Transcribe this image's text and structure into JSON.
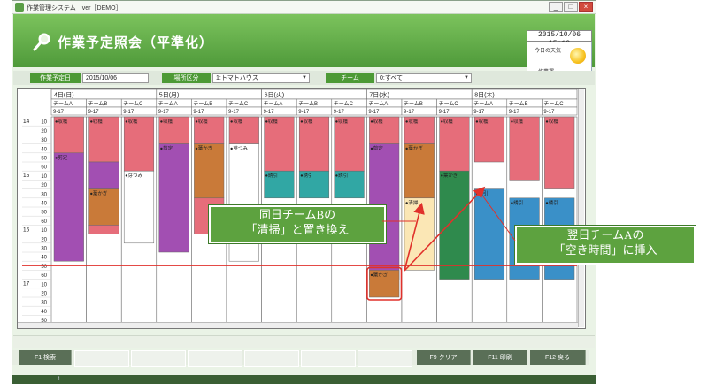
{
  "window": {
    "title": "作業管理システム　ver［DEMO］",
    "controls": [
      "_",
      "□",
      "×"
    ]
  },
  "header": {
    "title": "作業予定照会（平準化）",
    "clock": "2015/10/06  15:12",
    "widget_label_top": "今日の天気",
    "widget_label_bottom": "作業運"
  },
  "filters": {
    "date_label": "作業予定日",
    "date_value": "2015/10/06",
    "place_label": "場所区分",
    "place_value": "1:トマトハウス",
    "team_label": "チーム",
    "team_value": "0:すべて"
  },
  "function_keys": {
    "f1": "F1 検索",
    "f9": "F9 クリア",
    "f11": "F11 印刷",
    "f12": "F12 戻る"
  },
  "annotations": {
    "left_line1": "同日チームBの",
    "left_line2": "「清掃」と置き換え",
    "right_line1": "翌日チームAの",
    "right_line2": "「空き時間」に挿入"
  },
  "colors": {
    "accent_green": "#4f9a3a",
    "pink": "#e66d7a",
    "purple": "#a24fb2",
    "brown": "#c97a39",
    "teal": "#31a7a4",
    "dark_green": "#2f8a4d",
    "blue": "#3a90c8",
    "cream": "#fbe7b5",
    "red_line": "#e0312b"
  },
  "schedule": {
    "days": [
      {
        "label": "4日(日)",
        "teams": [
          "チームA",
          "チームB",
          "チームC"
        ]
      },
      {
        "label": "5日(月)",
        "teams": [
          "チームA",
          "チームB",
          "チームC"
        ]
      },
      {
        "label": "6日(火)",
        "teams": [
          "チームA",
          "チームB",
          "チームC"
        ]
      },
      {
        "label": "7日(水)",
        "teams": [
          "チームA",
          "チームB",
          "チームC"
        ]
      },
      {
        "label": "8日(木)",
        "teams": [
          "チームA",
          "チームB",
          "チームC"
        ]
      }
    ],
    "shift": "9-17",
    "hours": [
      "14",
      "15",
      "16",
      "17"
    ],
    "minutes": [
      "10",
      "20",
      "30",
      "40",
      "50",
      "60",
      "10",
      "20",
      "30",
      "40",
      "50",
      "60",
      "10",
      "20",
      "30",
      "40",
      "50",
      "60",
      "10",
      "20",
      "30",
      "40",
      "50"
    ],
    "columns": [
      [
        {
          "start": 0,
          "end": 4,
          "color": "pink",
          "label": "●収穫"
        },
        {
          "start": 4,
          "end": 16,
          "color": "purple",
          "label": "●剪定"
        }
      ],
      [
        {
          "start": 0,
          "end": 5,
          "color": "pink",
          "label": "●収穫"
        },
        {
          "start": 5,
          "end": 8,
          "color": "purple",
          "label": ""
        },
        {
          "start": 8,
          "end": 12,
          "color": "brown",
          "label": "●葉かぎ"
        },
        {
          "start": 12,
          "end": 13,
          "color": "pink",
          "label": ""
        }
      ],
      [
        {
          "start": 0,
          "end": 6,
          "color": "pink",
          "label": "●収穫"
        },
        {
          "start": 6,
          "end": 14,
          "color": "white",
          "label": "●芽つみ"
        }
      ],
      [
        {
          "start": 0,
          "end": 3,
          "color": "pink",
          "label": "●収穫"
        },
        {
          "start": 3,
          "end": 15,
          "color": "purple",
          "label": "●剪定"
        }
      ],
      [
        {
          "start": 0,
          "end": 3,
          "color": "pink",
          "label": "●収穫"
        },
        {
          "start": 3,
          "end": 9,
          "color": "brown",
          "label": "●葉かぎ"
        },
        {
          "start": 9,
          "end": 13,
          "color": "pink",
          "label": ""
        }
      ],
      [
        {
          "start": 0,
          "end": 3,
          "color": "pink",
          "label": "●収穫"
        },
        {
          "start": 3,
          "end": 16,
          "color": "white",
          "label": "●芽つみ"
        }
      ],
      [
        {
          "start": 0,
          "end": 6,
          "color": "pink",
          "label": "●収穫"
        },
        {
          "start": 6,
          "end": 9,
          "color": "teal",
          "label": "●誘引"
        }
      ],
      [
        {
          "start": 0,
          "end": 6,
          "color": "pink",
          "label": "●収穫"
        },
        {
          "start": 6,
          "end": 9,
          "color": "teal",
          "label": "●誘引"
        }
      ],
      [
        {
          "start": 0,
          "end": 6,
          "color": "pink",
          "label": "●収穫"
        },
        {
          "start": 6,
          "end": 9,
          "color": "teal",
          "label": "●誘引"
        }
      ],
      [
        {
          "start": 0,
          "end": 3,
          "color": "pink",
          "label": "●収穫"
        },
        {
          "start": 3,
          "end": 18,
          "color": "purple",
          "label": "●剪定"
        }
      ],
      [
        {
          "start": 0,
          "end": 3,
          "color": "pink",
          "label": "●収穫"
        },
        {
          "start": 3,
          "end": 9,
          "color": "brown",
          "label": "●葉かぎ"
        },
        {
          "start": 9,
          "end": 17,
          "color": "cream",
          "label": "●清掃"
        }
      ],
      [
        {
          "start": 0,
          "end": 6,
          "color": "pink",
          "label": "●収穫"
        },
        {
          "start": 6,
          "end": 18,
          "color": "dark_green",
          "label": "●葉かぎ"
        }
      ],
      [
        {
          "start": 0,
          "end": 5,
          "color": "pink",
          "label": "●収穫"
        },
        {
          "start": 8,
          "end": 18,
          "color": "blue",
          "label": "●誘引"
        }
      ],
      [
        {
          "start": 0,
          "end": 7,
          "color": "pink",
          "label": "●収穫"
        },
        {
          "start": 9,
          "end": 18,
          "color": "blue",
          "label": "●誘引"
        }
      ],
      [
        {
          "start": 0,
          "end": 8,
          "color": "pink",
          "label": "●収穫"
        },
        {
          "start": 9,
          "end": 18,
          "color": "blue",
          "label": "●誘引"
        }
      ]
    ],
    "inserted": {
      "column": 9,
      "start": 17,
      "end": 20,
      "color": "brown",
      "label": "●葉かぎ"
    }
  }
}
